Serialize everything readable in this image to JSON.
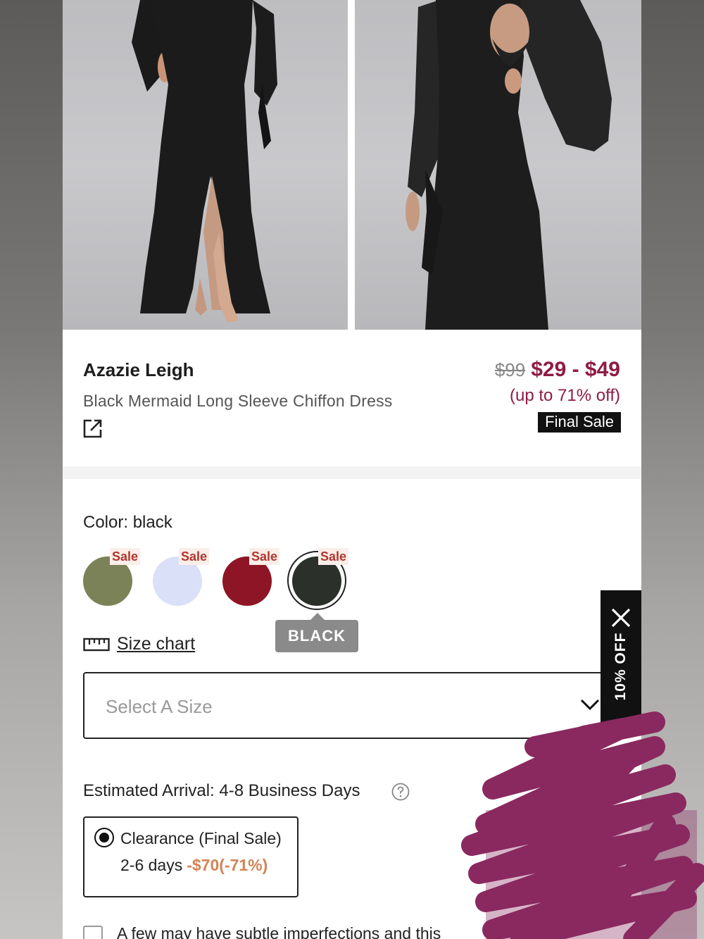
{
  "product": {
    "brand": "Azazie Leigh",
    "name": "Black Mermaid Long Sleeve Chiffon Dress",
    "old_price": "$99",
    "price_range": "$29 - $49",
    "discount": "(up to 71% off)",
    "badge": "Final Sale"
  },
  "color": {
    "label": "Color: black",
    "tooltip": "BLACK",
    "swatches": [
      {
        "name": "green",
        "hex": "#7b8258",
        "tag": "Sale"
      },
      {
        "name": "lilac",
        "hex": "#d9e0f7",
        "tag": "Sale"
      },
      {
        "name": "red",
        "hex": "#8d1526",
        "tag": "Sale"
      },
      {
        "name": "black",
        "hex": "#2c302b",
        "tag": "Sale"
      }
    ]
  },
  "size": {
    "chart_label": "Size chart",
    "placeholder": "Select A Size"
  },
  "promo_tab": {
    "label": "10% OFF"
  },
  "shipping": {
    "arrival": "Estimated Arrival: 4-8 Business Days",
    "option_title": "Clearance (Final Sale)",
    "option_days": "2-6 days",
    "option_saving": "-$70(-71%)"
  },
  "note": {
    "text": "A few may have subtle imperfections and this"
  },
  "colors": {
    "accent": "#8f1b45",
    "saving": "#d28457",
    "scribble": "#8a2960"
  }
}
